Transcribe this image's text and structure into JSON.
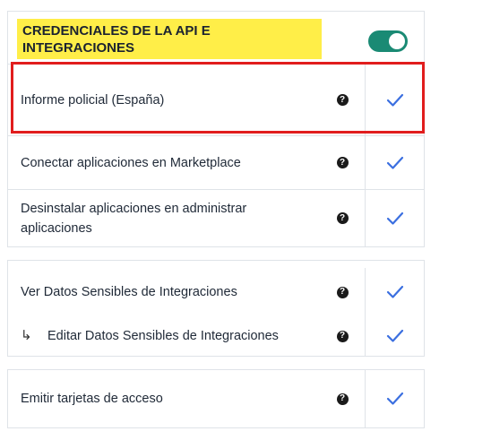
{
  "section": {
    "title": "CREDENCIALES DE LA API E INTEGRACIONES",
    "toggle_enabled": true
  },
  "colors": {
    "highlight_bg": "#ffee48",
    "toggle_on": "#1a8a74",
    "check": "#3b6fe0",
    "selection_border": "#e11d1d"
  },
  "group1": [
    {
      "label": "Informe policial (España)",
      "help_icon": "question-circle-icon",
      "checked": true
    },
    {
      "label": "Conectar aplicaciones en Marketplace",
      "help_icon": "question-circle-icon",
      "checked": true
    },
    {
      "label": "Desinstalar aplicaciones en administrar aplicaciones",
      "help_icon": "question-circle-icon",
      "checked": true
    }
  ],
  "group2": [
    {
      "label": "Ver Datos Sensibles de Integraciones",
      "help_icon": "question-circle-icon",
      "checked": true
    },
    {
      "label": "Editar Datos Sensibles de Integraciones",
      "help_icon": "question-circle-icon",
      "checked": true,
      "indent_symbol": "↳"
    }
  ],
  "group3": [
    {
      "label": "Emitir tarjetas de acceso",
      "help_icon": "question-circle-icon",
      "checked": true
    }
  ]
}
